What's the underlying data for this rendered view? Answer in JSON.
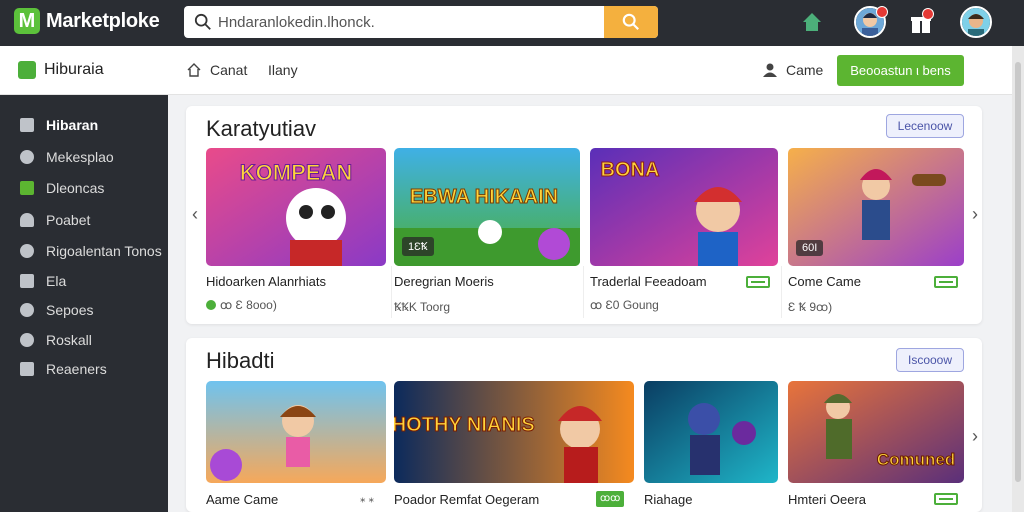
{
  "header": {
    "logo_letter": "M",
    "logo_text": "Marketploke",
    "search_placeholder": "Hndaranlokedin.lhonck."
  },
  "subheader": {
    "brand": "Hiburaia",
    "nav": [
      {
        "label": "Canat",
        "icon": "home-outline-icon"
      },
      {
        "label": "Ilany"
      }
    ],
    "game_link": "Came",
    "cta_label": "Beooastun ι bens"
  },
  "sidebar": {
    "items": [
      {
        "label": "Hibaran",
        "icon": "grid-icon",
        "active": true
      },
      {
        "label": "Mekesplao",
        "icon": "gamepad-icon"
      },
      {
        "label": "Dleoncas",
        "icon": "calendar-icon"
      },
      {
        "label": "Poabet",
        "icon": "user-icon"
      },
      {
        "label": "Rigoalentan Tonos",
        "icon": "gamepad-icon"
      },
      {
        "label": "Ela",
        "icon": "tile-icon"
      },
      {
        "label": "Sepoes",
        "icon": "settings-icon"
      },
      {
        "label": "Roskall",
        "icon": "globe-icon"
      },
      {
        "label": "Reaeners",
        "icon": "check-icon"
      }
    ]
  },
  "section1": {
    "title": "Karatyutiav",
    "button": "Lecenoow",
    "cards": [
      {
        "thumb_text": "KOMPEAN",
        "title": "Hidoarken Alanrhiats",
        "meta": "ꝏ Ɛ 8ooo)"
      },
      {
        "thumb_text": "EBWA HIKAAIN",
        "tag": "1ƐꝄ",
        "title": "Deregrian Moeris",
        "meta": "ꝄꝄK Toorg"
      },
      {
        "thumb_text": "BONA",
        "title": "Traderlal Feeadoam",
        "meta": "ꝏ Ɛ0 Goung"
      },
      {
        "thumb_text": "",
        "tag": "60I",
        "title": "Come Came",
        "meta": "Ɛ Ꝅ 9ꝏ)"
      }
    ]
  },
  "section2": {
    "title": "Hibadti",
    "button": "Iscooow",
    "cards": [
      {
        "thumb_text": "",
        "title": "Aame Came",
        "meta": "⁎ ⁎"
      },
      {
        "thumb_text": "BHOTHY NIANIS",
        "title": "Poador Remfat Oegeram",
        "pill": "ꝏꝏ"
      },
      {
        "thumb_text": "",
        "title": "Riahage"
      },
      {
        "thumb_text": "Comuned",
        "title": "Hmteri Oeera"
      }
    ]
  },
  "colors": {
    "topbar": "#2a2d33",
    "accent_green": "#5cb531",
    "search_button": "#f4b03e"
  }
}
